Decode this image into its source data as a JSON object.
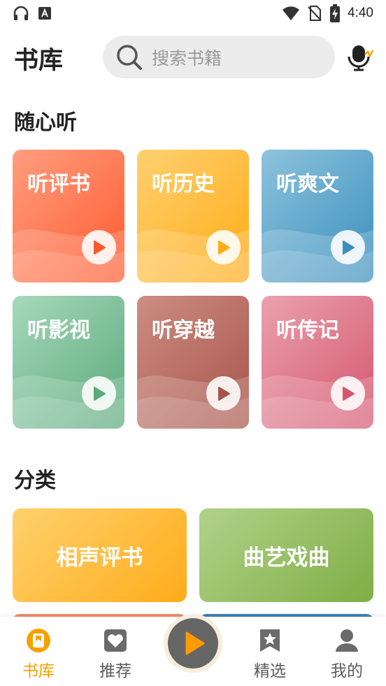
{
  "status_bar": {
    "time": "4:40",
    "icons": [
      "headset-icon",
      "keyboard-a-icon",
      "wifi-icon",
      "no-sim-icon",
      "battery-charging-icon"
    ]
  },
  "header": {
    "title": "书库",
    "search_placeholder": "搜索书籍",
    "search_icon": "search-icon",
    "mic_icon": "voice-search-icon"
  },
  "listen_section": {
    "title": "随心听",
    "cards": [
      {
        "label": "听评书",
        "color_start": "#ff9e80",
        "color_end": "#ff5a2e"
      },
      {
        "label": "听历史",
        "color_start": "#ffd070",
        "color_end": "#ffac16"
      },
      {
        "label": "听爽文",
        "color_start": "#8ec3dd",
        "color_end": "#3a8fbd"
      },
      {
        "label": "听影视",
        "color_start": "#a6d8bb",
        "color_end": "#5ba97b"
      },
      {
        "label": "听穿越",
        "color_start": "#cc8d82",
        "color_end": "#a8544a"
      },
      {
        "label": "听传记",
        "color_start": "#eaa1ad",
        "color_end": "#d4566f"
      }
    ]
  },
  "category_section": {
    "title": "分类",
    "cards": [
      {
        "label": "相声评书",
        "color_start": "#ffd16d",
        "color_end": "#ffac1a"
      },
      {
        "label": "曲艺戏曲",
        "color_start": "#b0d28a",
        "color_end": "#80ae45"
      }
    ]
  },
  "tabbar": {
    "tabs": [
      {
        "label": "书库",
        "icon": "bookshelf-icon",
        "active": true
      },
      {
        "label": "推荐",
        "icon": "heart-icon",
        "active": false
      },
      {
        "label": "精选",
        "icon": "star-bookmark-icon",
        "active": false
      },
      {
        "label": "我的",
        "icon": "user-icon",
        "active": false
      }
    ],
    "center_icon": "play-icon",
    "accent": "#f5a100"
  }
}
